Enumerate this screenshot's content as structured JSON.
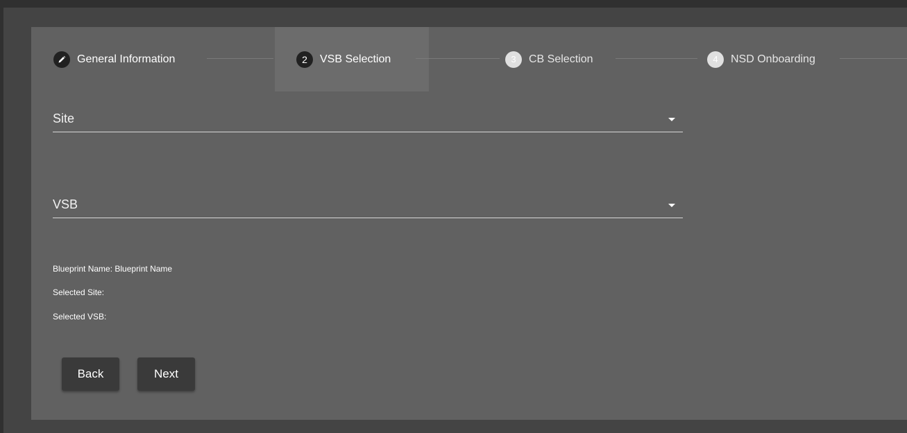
{
  "stepper": {
    "steps": [
      {
        "label": "General Information",
        "marker": "",
        "icon": "pencil-icon",
        "state": "done"
      },
      {
        "label": "VSB Selection",
        "marker": "2",
        "state": "current"
      },
      {
        "label": "CB Selection",
        "marker": "3",
        "state": "pending"
      },
      {
        "label": "NSD Onboarding",
        "marker": "4",
        "state": "pending"
      }
    ]
  },
  "form": {
    "site_label": "Site",
    "vsb_label": "VSB"
  },
  "summary": {
    "blueprint_name": "Blueprint Name: Blueprint Name",
    "selected_site": "Selected Site:",
    "selected_vsb": "Selected VSB:"
  },
  "actions": {
    "back_label": "Back",
    "next_label": "Next"
  },
  "colors": {
    "card": "#616161",
    "active_step": "#6c6c6c",
    "button": "#3a3a3a"
  }
}
